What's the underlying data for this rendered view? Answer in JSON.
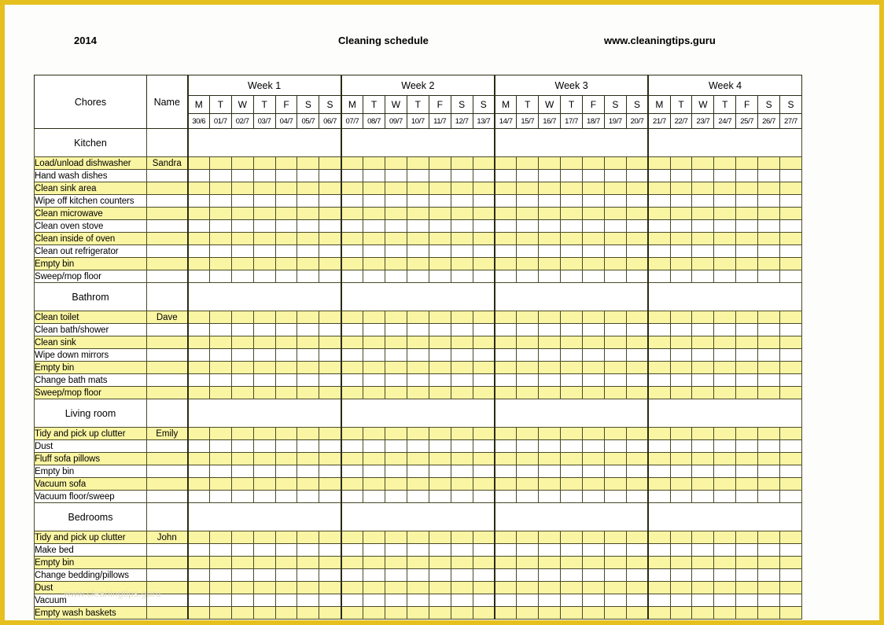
{
  "page": {
    "border_color": "#e5c01f",
    "background": "#ffffff",
    "row_highlight_color": "#faf5a3",
    "grid_line_color": "#4a4a28",
    "watermark": "www.cleaningtips.guru"
  },
  "header": {
    "year": "2014",
    "title": "Cleaning schedule",
    "website": "www.cleaningtips.guru"
  },
  "table": {
    "col_chores": "Chores",
    "col_name": "Name",
    "weeks": [
      {
        "label": "Week 1",
        "days": [
          "M",
          "T",
          "W",
          "T",
          "F",
          "S",
          "S"
        ],
        "dates": [
          "30/6",
          "01/7",
          "02/7",
          "03/7",
          "04/7",
          "05/7",
          "06/7"
        ]
      },
      {
        "label": "Week 2",
        "days": [
          "M",
          "T",
          "W",
          "T",
          "F",
          "S",
          "S"
        ],
        "dates": [
          "07/7",
          "08/7",
          "09/7",
          "10/7",
          "11/7",
          "12/7",
          "13/7"
        ]
      },
      {
        "label": "Week 3",
        "days": [
          "M",
          "T",
          "W",
          "T",
          "F",
          "S",
          "S"
        ],
        "dates": [
          "14/7",
          "15/7",
          "16/7",
          "17/7",
          "18/7",
          "19/7",
          "20/7"
        ]
      },
      {
        "label": "Week 4",
        "days": [
          "M",
          "T",
          "W",
          "T",
          "F",
          "S",
          "S"
        ],
        "dates": [
          "21/7",
          "22/7",
          "23/7",
          "24/7",
          "25/7",
          "26/7",
          "27/7"
        ]
      }
    ],
    "sections": [
      {
        "title": "Kitchen",
        "rows": [
          {
            "chore": "Load/unload dishwasher",
            "name": "Sandra"
          },
          {
            "chore": "Hand wash dishes",
            "name": ""
          },
          {
            "chore": "Clean sink area",
            "name": ""
          },
          {
            "chore": "Wipe off kitchen counters",
            "name": ""
          },
          {
            "chore": "Clean microwave",
            "name": ""
          },
          {
            "chore": "Clean oven stove",
            "name": ""
          },
          {
            "chore": "Clean inside of oven",
            "name": ""
          },
          {
            "chore": "Clean out refrigerator",
            "name": ""
          },
          {
            "chore": "Empty bin",
            "name": ""
          },
          {
            "chore": "Sweep/mop floor",
            "name": ""
          }
        ]
      },
      {
        "title": "Bathrom",
        "rows": [
          {
            "chore": "Clean toilet",
            "name": "Dave"
          },
          {
            "chore": "Clean bath/shower",
            "name": ""
          },
          {
            "chore": "Clean sink",
            "name": ""
          },
          {
            "chore": "Wipe down mirrors",
            "name": ""
          },
          {
            "chore": "Empty bin",
            "name": ""
          },
          {
            "chore": "Change bath mats",
            "name": ""
          },
          {
            "chore": "Sweep/mop floor",
            "name": ""
          }
        ]
      },
      {
        "title": "Living room",
        "rows": [
          {
            "chore": "Tidy and pick up clutter",
            "name": "Emily"
          },
          {
            "chore": "Dust",
            "name": ""
          },
          {
            "chore": "Fluff sofa pillows",
            "name": ""
          },
          {
            "chore": "Empty bin",
            "name": ""
          },
          {
            "chore": "Vacuum sofa",
            "name": ""
          },
          {
            "chore": "Vacuum floor/sweep",
            "name": ""
          }
        ]
      },
      {
        "title": "Bedrooms",
        "rows": [
          {
            "chore": "Tidy and pick up clutter",
            "name": "John"
          },
          {
            "chore": "Make bed",
            "name": ""
          },
          {
            "chore": "Empty bin",
            "name": ""
          },
          {
            "chore": "Change bedding/pillows",
            "name": ""
          },
          {
            "chore": "Dust",
            "name": ""
          },
          {
            "chore": "Vacuum",
            "name": ""
          },
          {
            "chore": "Empty wash baskets",
            "name": ""
          }
        ]
      }
    ]
  }
}
